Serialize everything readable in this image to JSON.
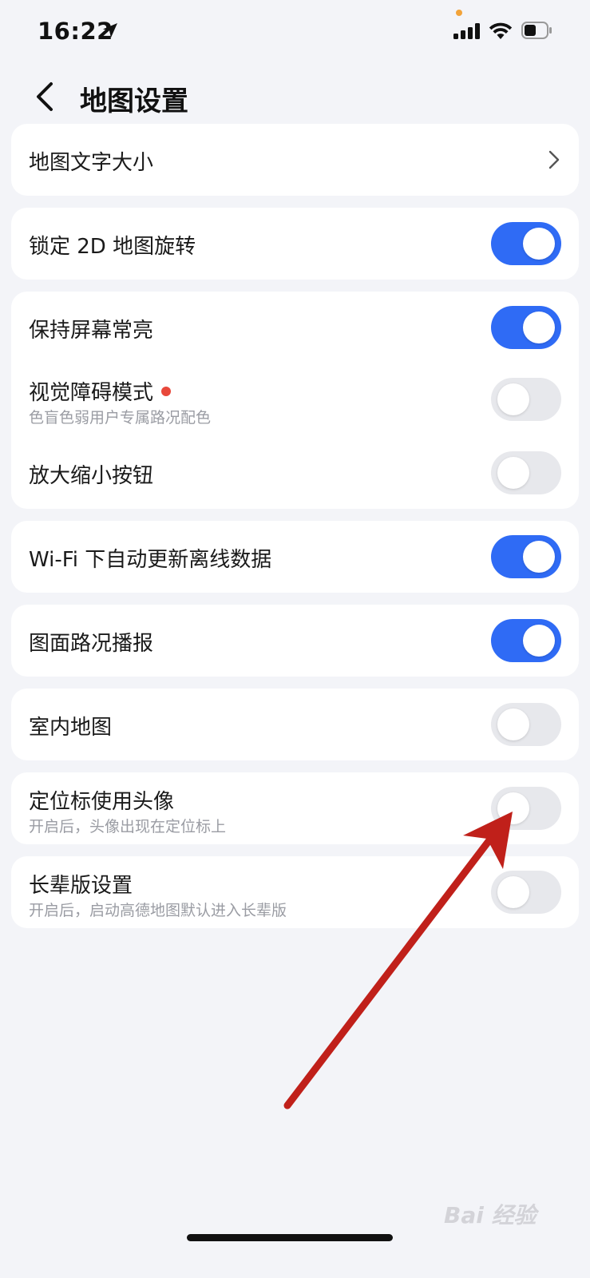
{
  "status_bar": {
    "time": "16:22"
  },
  "header": {
    "title": "地图设置"
  },
  "settings": {
    "map_text_size": {
      "label": "地图文字大小"
    },
    "lock_2d_rotation": {
      "label": "锁定 2D 地图旋转",
      "enabled": true
    },
    "keep_screen_on": {
      "label": "保持屏幕常亮",
      "enabled": true
    },
    "visual_impairment": {
      "label": "视觉障碍模式",
      "sublabel": "色盲色弱用户专属路况配色",
      "enabled": false
    },
    "zoom_buttons": {
      "label": "放大缩小按钮",
      "enabled": false
    },
    "wifi_auto_update": {
      "label": "Wi-Fi 下自动更新离线数据",
      "enabled": true
    },
    "traffic_broadcast": {
      "label": "图面路况播报",
      "enabled": true
    },
    "indoor_map": {
      "label": "室内地图",
      "enabled": false
    },
    "avatar_locator": {
      "label": "定位标使用头像",
      "sublabel": "开启后，头像出现在定位标上",
      "enabled": false
    },
    "elder_mode": {
      "label": "长辈版设置",
      "sublabel": "开启后，启动高德地图默认进入长辈版",
      "enabled": false
    }
  },
  "colors": {
    "toggle_on": "#2f6bf5",
    "toggle_off": "#e7e8ec",
    "annotation_arrow": "#c0201a"
  },
  "watermark": "Bai 经验"
}
